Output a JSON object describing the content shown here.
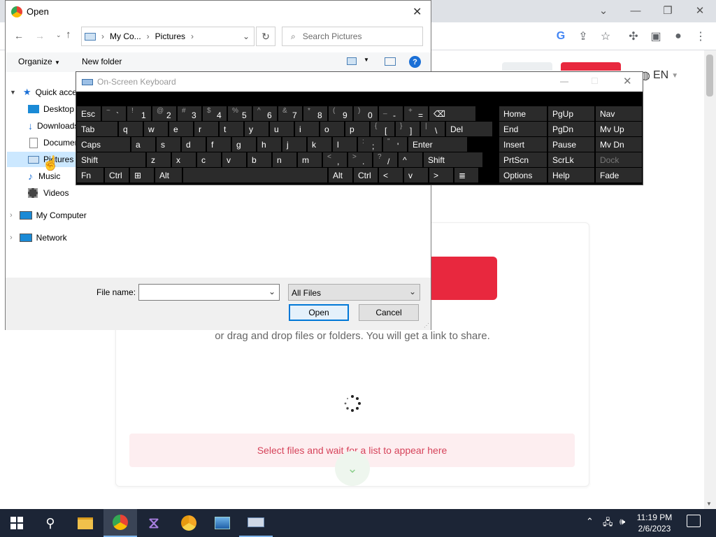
{
  "browser": {
    "lang_label": "EN"
  },
  "website": {
    "drag_text": "or drag and drop files or folders. You will get a link to share.",
    "select_banner": "Select files and wait for a list to appear here",
    "colors": {
      "accent": "#e8283e",
      "banner_bg": "#fdeef0",
      "banner_text": "#d6435a"
    }
  },
  "dialog": {
    "title": "Open",
    "breadcrumb": [
      "My Co...",
      "Pictures"
    ],
    "search_placeholder": "Search Pictures",
    "organize_label": "Organize",
    "new_folder_label": "New folder",
    "nav": {
      "quick_access": "Quick access",
      "desktop": "Desktop",
      "downloads": "Downloads",
      "documents": "Documents",
      "pictures": "Pictures",
      "music": "Music",
      "videos": "Videos",
      "my_computer": "My Computer",
      "network": "Network"
    },
    "file_name_label": "File name:",
    "file_name_value": "",
    "file_type_value": "All Files",
    "open_label": "Open",
    "cancel_label": "Cancel"
  },
  "osk": {
    "title": "On-Screen Keyboard",
    "rows": [
      [
        {
          "m": "Esc"
        },
        {
          "s": "~",
          "m": "`"
        },
        {
          "s": "!",
          "m": "1"
        },
        {
          "s": "@",
          "m": "2"
        },
        {
          "s": "#",
          "m": "3"
        },
        {
          "s": "$",
          "m": "4"
        },
        {
          "s": "%",
          "m": "5"
        },
        {
          "s": "^",
          "m": "6"
        },
        {
          "s": "&",
          "m": "7"
        },
        {
          "s": "*",
          "m": "8"
        },
        {
          "s": "(",
          "m": "9"
        },
        {
          "s": ")",
          "m": "0"
        },
        {
          "s": "_",
          "m": "-"
        },
        {
          "s": "+",
          "m": "="
        },
        {
          "m": "⌫"
        }
      ],
      [
        {
          "m": "Tab"
        },
        {
          "m": "q"
        },
        {
          "m": "w"
        },
        {
          "m": "e"
        },
        {
          "m": "r"
        },
        {
          "m": "t"
        },
        {
          "m": "y"
        },
        {
          "m": "u"
        },
        {
          "m": "i"
        },
        {
          "m": "o"
        },
        {
          "m": "p"
        },
        {
          "s": "{",
          "m": "["
        },
        {
          "s": "}",
          "m": "]"
        },
        {
          "s": "|",
          "m": "\\"
        },
        {
          "m": "Del"
        }
      ],
      [
        {
          "m": "Caps"
        },
        {
          "m": "a"
        },
        {
          "m": "s"
        },
        {
          "m": "d"
        },
        {
          "m": "f"
        },
        {
          "m": "g"
        },
        {
          "m": "h"
        },
        {
          "m": "j"
        },
        {
          "m": "k"
        },
        {
          "m": "l"
        },
        {
          "s": ":",
          "m": ";"
        },
        {
          "s": "\"",
          "m": "'"
        },
        {
          "m": "Enter"
        }
      ],
      [
        {
          "m": "Shift"
        },
        {
          "m": "z"
        },
        {
          "m": "x"
        },
        {
          "m": "c"
        },
        {
          "m": "v"
        },
        {
          "m": "b"
        },
        {
          "m": "n"
        },
        {
          "m": "m"
        },
        {
          "s": "<",
          "m": ","
        },
        {
          "s": ">",
          "m": "."
        },
        {
          "s": "?",
          "m": "/"
        },
        {
          "m": "^"
        },
        {
          "m": "Shift"
        }
      ],
      [
        {
          "m": "Fn"
        },
        {
          "m": "Ctrl"
        },
        {
          "m": "⊞"
        },
        {
          "m": "Alt"
        },
        {
          "m": ""
        },
        {
          "m": "Alt"
        },
        {
          "m": "Ctrl"
        },
        {
          "m": "<"
        },
        {
          "m": "v"
        },
        {
          "m": ">"
        },
        {
          "m": "≣"
        }
      ]
    ],
    "nav_keys": [
      [
        "Home",
        "PgUp",
        "Nav"
      ],
      [
        "End",
        "PgDn",
        "Mv Up"
      ],
      [
        "Insert",
        "Pause",
        "Mv Dn"
      ],
      [
        "PrtScn",
        "ScrLk",
        "Dock"
      ],
      [
        "Options",
        "Help",
        "Fade"
      ]
    ]
  },
  "taskbar": {
    "time": "11:19 PM",
    "date": "2/6/2023"
  }
}
